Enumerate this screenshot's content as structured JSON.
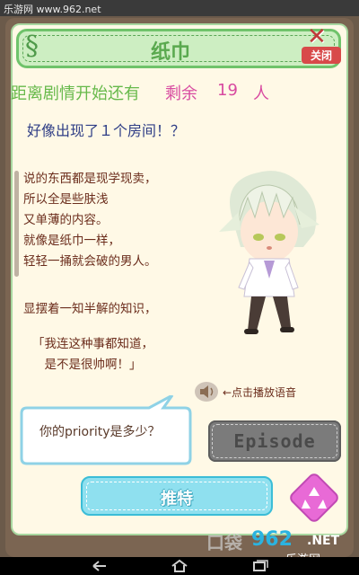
{
  "watermark_top": "乐游网 www.962.net",
  "header": {
    "section_mark": "§",
    "title": "纸巾",
    "close_label": "关闭"
  },
  "countdown": {
    "label": "距离剧情开始还有",
    "remaining_label": "剩余",
    "count": "19",
    "unit": "人"
  },
  "headline": "好像出现了１个房间！？",
  "paragraph1": [
    "说的东西都是现学现卖，",
    "所以全是些肤浅",
    "又单薄的内容。",
    "就像是纸巾一样，",
    "轻轻一捅就会破的男人。"
  ],
  "paragraph2": "显摆着一知半解的知识，",
  "quote": [
    "「我连这种事都知道，",
    "　是不是很帅啊！」"
  ],
  "sound_hint": "←点击播放语音",
  "question_bubble": "你的priority是多少？",
  "episode_button": "Episode",
  "recommend_button": "推特",
  "watermark_bottom": {
    "brand_zh": "口袋",
    "brand_num": "962",
    "brand_net": ".NET",
    "brand_cn": "乐游网"
  },
  "colors": {
    "header_green": "#6fc36b",
    "panel_bg": "#fff9e6",
    "pink": "#d84aa0",
    "countdown_green": "#66b94a",
    "text_brown": "#6b2d1c",
    "headline_blue": "#2f3e86",
    "recommend_cyan": "#8fe0ef",
    "recycle_pink": "#e86ad6"
  },
  "icons": [
    "close-x-icon",
    "speaker-icon",
    "recycle-icon",
    "back-icon",
    "home-icon",
    "recent-apps-icon"
  ]
}
